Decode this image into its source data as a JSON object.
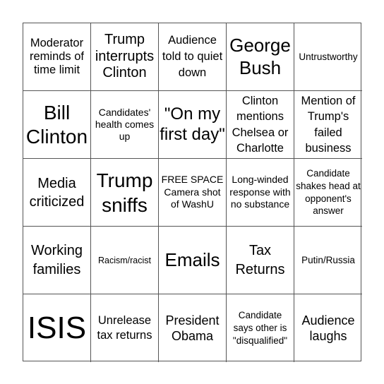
{
  "board": {
    "cells": [
      {
        "text": "Moderator reminds of time limit",
        "free": false
      },
      {
        "text": "Trump interrupts Clinton",
        "free": false
      },
      {
        "text": "Audience told to quiet down",
        "free": false
      },
      {
        "text": "George Bush",
        "free": false
      },
      {
        "text": "Untrustworthy",
        "free": false
      },
      {
        "text": "Bill Clinton",
        "free": false
      },
      {
        "text": "Candidates' health comes up",
        "free": false
      },
      {
        "text": "\"On my first day\"",
        "free": false
      },
      {
        "text": "Clinton mentions Chelsea or Charlotte",
        "free": false
      },
      {
        "text": "Mention of Trump's failed business",
        "free": false
      },
      {
        "text": "Media criticized",
        "free": false
      },
      {
        "text": "Trump sniffs",
        "free": false
      },
      {
        "text": "FREE SPACE Camera shot of WashU",
        "free": true
      },
      {
        "text": "Long-winded response with no substance",
        "free": false
      },
      {
        "text": "Candidate shakes head at opponent's answer",
        "free": false
      },
      {
        "text": "Working families",
        "free": false
      },
      {
        "text": "Racism/racist",
        "free": false
      },
      {
        "text": "Emails",
        "free": false
      },
      {
        "text": "Tax Returns",
        "free": false
      },
      {
        "text": "Putin/Russia",
        "free": false
      },
      {
        "text": "ISIS",
        "free": false
      },
      {
        "text": "Unrelease tax returns",
        "free": false
      },
      {
        "text": "President Obama",
        "free": false
      },
      {
        "text": "Candidate says other is \"disqualified\"",
        "free": false
      },
      {
        "text": "Audience laughs",
        "free": false
      }
    ]
  }
}
